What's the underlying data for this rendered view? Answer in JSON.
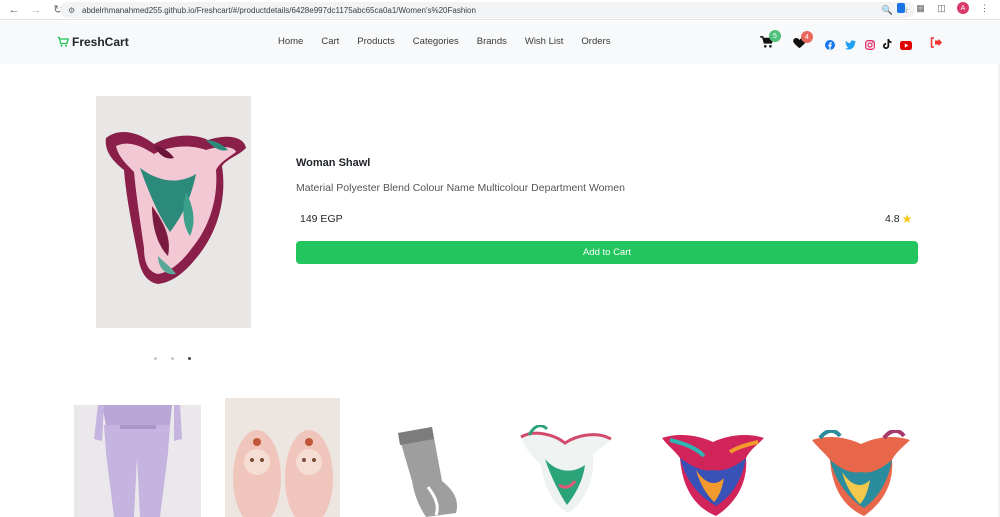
{
  "browser": {
    "url": "abdelrhmanahmed255.github.io/Freshcart/#/productdetails/6428e997dc1175abc65ca0a1/Women's%20Fashion",
    "profile_initial": "A"
  },
  "navbar": {
    "brand": "FreshCart",
    "links": [
      "Home",
      "Cart",
      "Products",
      "Categories",
      "Brands",
      "Wish List",
      "Orders"
    ],
    "cart_count": "5",
    "wishlist_count": "4",
    "colors": {
      "accent": "#22c55e",
      "background": "#f8f9fa"
    }
  },
  "product": {
    "title": "Woman Shawl",
    "description": "Material Polyester Blend Colour Name Multicolour Department Women",
    "price": "149 EGP",
    "rating": "4.8",
    "add_to_cart": "Add to Cart",
    "slider_active_index": 3,
    "slider_total": 3
  },
  "related": [
    {
      "name": "lavender-sweatpants-image"
    },
    {
      "name": "pink-slippers-image"
    },
    {
      "name": "grey-socks-image"
    },
    {
      "name": "floral-scarf-image"
    },
    {
      "name": "colorful-scarf-image"
    },
    {
      "name": "patterned-scarf-image"
    }
  ]
}
